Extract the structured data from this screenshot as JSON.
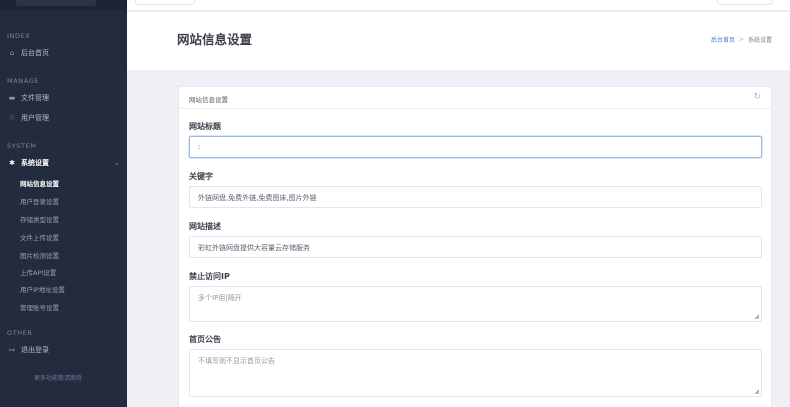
{
  "sidebar": {
    "sections": {
      "index": "INDEX",
      "manage": "MANAGE",
      "system": "SYSTEM",
      "other": "OTHER"
    },
    "items": {
      "home": "后台首页",
      "files": "文件管理",
      "users": "用户管理",
      "settings": "系统设置",
      "logout": "退出登录"
    },
    "subitems": [
      "网站信息设置",
      "用户登录设置",
      "存储类型设置",
      "文件上传设置",
      "图片检测设置",
      "上传API设置",
      "用户IP地址设置",
      "管理账号设置"
    ],
    "footer": "更多功能敬请期待"
  },
  "header": {
    "title": "网站信息设置",
    "breadcrumb": {
      "home": "后台首页",
      "separator": ">",
      "current": "系统设置"
    }
  },
  "card": {
    "title": "网站信息设置",
    "fields": {
      "site_title": {
        "label": "网站标题",
        "value": ":"
      },
      "keywords": {
        "label": "关键字",
        "value": "外链网盘,免费外链,免费图床,图片外链"
      },
      "description": {
        "label": "网站描述",
        "value": "彩虹外链网盘提供大容量云存储服务"
      },
      "blocked_ip": {
        "label": "禁止访问IP",
        "placeholder": "多个IP用|隔开"
      },
      "announcement": {
        "label": "首页公告",
        "placeholder": "不填写则不显示首页公告"
      }
    }
  },
  "icons": {
    "home": "home-icon",
    "folder": "folder-icon",
    "users": "users-icon",
    "gear": "gear-icon",
    "logout": "logout-icon",
    "refresh": "refresh-icon",
    "chevron": "chevron-down-icon"
  },
  "colors": {
    "sidebar_bg": "#232b3e",
    "accent": "#3b74d8",
    "focus_border": "#9db8e6"
  }
}
